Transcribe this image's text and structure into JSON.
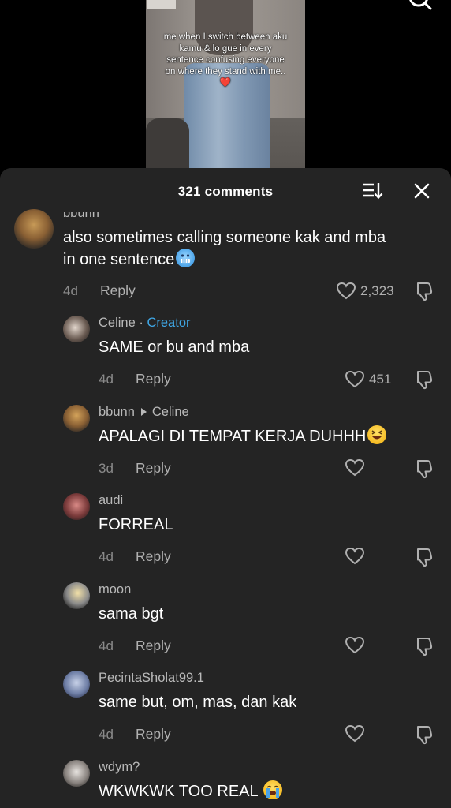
{
  "video": {
    "caption": "me when I switch between aku kamu & lo gue in every sentence confusing everyone on where they stand with me..",
    "caption_heart": "❤️"
  },
  "header": {
    "comment_count": "321 comments"
  },
  "comments": [
    {
      "username": "bbunn",
      "text_line1": "also sometimes calling someone kak and mba",
      "text_line2": "in one sentence",
      "emoji": "cold-face",
      "time": "4d",
      "reply": "Reply",
      "likes": "2,323"
    },
    {
      "username": "Celine",
      "separator": "·",
      "badge": "Creator",
      "text": "SAME or bu and mba",
      "time": "4d",
      "reply": "Reply",
      "likes": "451"
    },
    {
      "username": "bbunn",
      "reply_to": "Celine",
      "text": "APALAGI DI TEMPAT KERJA DUHHH",
      "emoji": "grinning-squinting-face",
      "time": "3d",
      "reply": "Reply"
    },
    {
      "username": "audi",
      "text": "FORREAL",
      "time": "4d",
      "reply": "Reply"
    },
    {
      "username": "moon",
      "text": "sama bgt",
      "time": "4d",
      "reply": "Reply"
    },
    {
      "username": "PecintaSholat99.1",
      "text": "same but, om, mas, dan kak",
      "time": "4d",
      "reply": "Reply"
    },
    {
      "username": "wdym?",
      "text": "WKWKWK TOO REAL",
      "emoji": "loudly-crying-face"
    }
  ],
  "colors": {
    "sheet_bg": "#242424",
    "creator_badge": "#3fa7e6",
    "muted": "#8a8a8a"
  },
  "icons": [
    "search-icon",
    "sort-icon",
    "close-icon",
    "heart-icon",
    "dislike-icon"
  ]
}
